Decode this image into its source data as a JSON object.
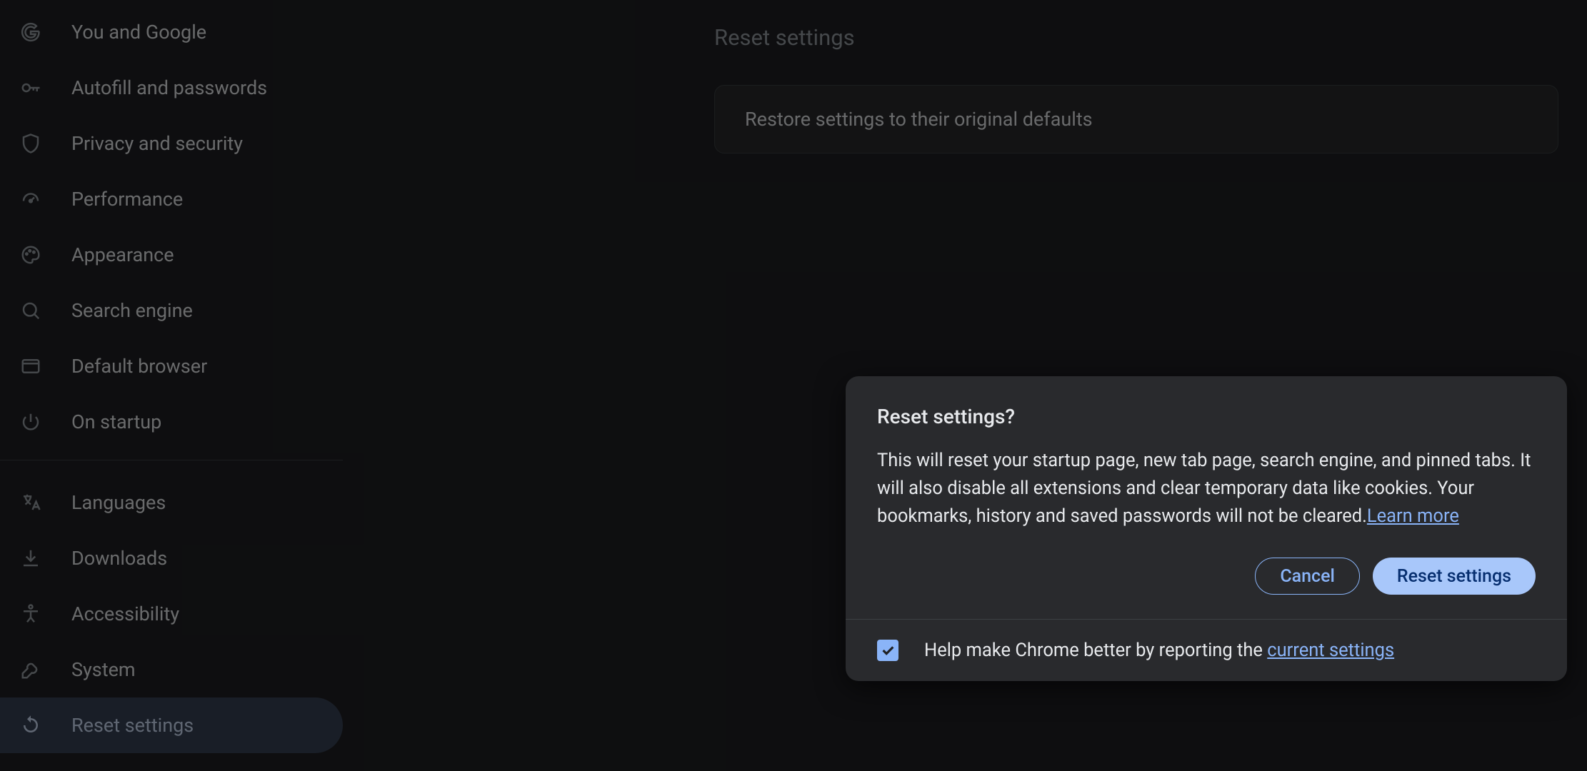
{
  "sidebar": {
    "items": [
      {
        "label": "You and Google",
        "icon": "google-icon"
      },
      {
        "label": "Autofill and passwords",
        "icon": "key-icon"
      },
      {
        "label": "Privacy and security",
        "icon": "shield-icon"
      },
      {
        "label": "Performance",
        "icon": "speed-icon"
      },
      {
        "label": "Appearance",
        "icon": "palette-icon"
      },
      {
        "label": "Search engine",
        "icon": "search-icon"
      },
      {
        "label": "Default browser",
        "icon": "browser-icon"
      },
      {
        "label": "On startup",
        "icon": "power-icon"
      }
    ],
    "items2": [
      {
        "label": "Languages",
        "icon": "language-icon"
      },
      {
        "label": "Downloads",
        "icon": "download-icon"
      },
      {
        "label": "Accessibility",
        "icon": "accessibility-icon"
      },
      {
        "label": "System",
        "icon": "wrench-icon"
      },
      {
        "label": "Reset settings",
        "icon": "reset-icon",
        "active": true
      }
    ]
  },
  "main": {
    "section_title": "Reset settings",
    "row_label": "Restore settings to their original defaults"
  },
  "dialog": {
    "title": "Reset settings?",
    "body": "This will reset your startup page, new tab page, search engine, and pinned tabs. It will also disable all extensions and clear temporary data like cookies. Your bookmarks, history and saved passwords will not be cleared.",
    "learn_more": "Learn more",
    "cancel": "Cancel",
    "confirm": "Reset settings",
    "report_text": "Help make Chrome better by reporting the ",
    "report_link": "current settings",
    "checkbox_checked": true
  }
}
